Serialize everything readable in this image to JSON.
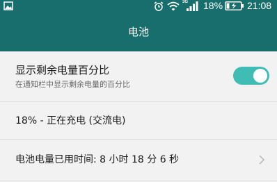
{
  "status_bar": {
    "battery_percent": "18%",
    "time": "21:08",
    "signal_badge": "3G",
    "battery_charging": true,
    "icons": [
      "gallery-icon",
      "alarm-icon",
      "wifi-icon",
      "signal-icon",
      "battery-charging-icon"
    ]
  },
  "header": {
    "title": "电池"
  },
  "settings": {
    "show_percentage": {
      "title": "显示剩余电量百分比",
      "subtitle": "在通知栏中显示剩余电量的百分比",
      "enabled": true
    },
    "charging_status": {
      "title": "18% - 正在充电 (交流电)"
    },
    "usage_time": {
      "title": "电池电量已用时间: 8 小时 18 分 6 秒"
    }
  },
  "colors": {
    "toolbar": "#186e6c",
    "accent": "#3fbdb4",
    "background": "#f2f2f2"
  }
}
